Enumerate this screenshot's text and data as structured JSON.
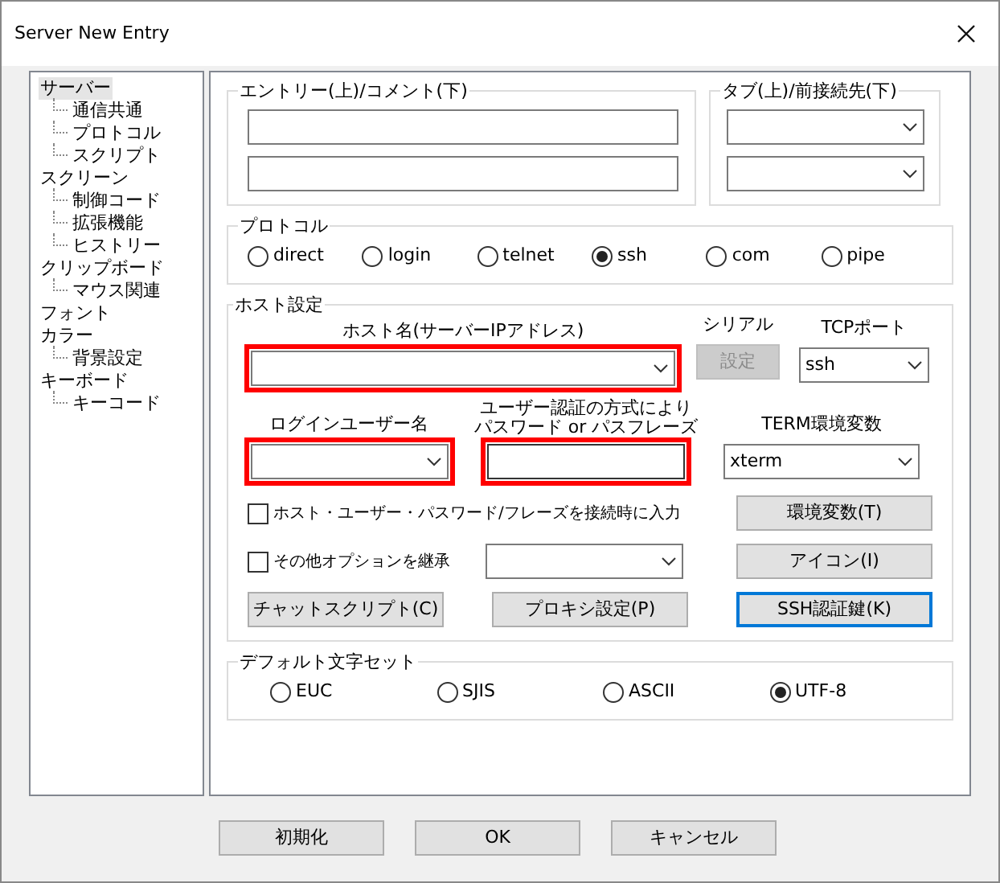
{
  "window": {
    "title": "Server New Entry"
  },
  "tree": [
    {
      "label": "サーバー",
      "selected": true,
      "children": [
        {
          "label": "通信共通",
          "selected": false
        },
        {
          "label": "プロトコル",
          "selected": false
        },
        {
          "label": "スクリプト",
          "selected": false
        }
      ]
    },
    {
      "label": "スクリーン",
      "selected": false,
      "children": [
        {
          "label": "制御コード",
          "selected": false
        },
        {
          "label": "拡張機能",
          "selected": false
        },
        {
          "label": "ヒストリー",
          "selected": false
        }
      ]
    },
    {
      "label": "クリップボード",
      "selected": false,
      "children": [
        {
          "label": "マウス関連",
          "selected": false
        }
      ]
    },
    {
      "label": "フォント",
      "selected": false
    },
    {
      "label": "カラー",
      "selected": false,
      "children": [
        {
          "label": "背景設定",
          "selected": false
        }
      ]
    },
    {
      "label": "キーボード",
      "selected": false,
      "children": [
        {
          "label": "キーコード",
          "selected": false
        }
      ]
    }
  ],
  "entry_group": {
    "title": "エントリー(上)/コメント(下)"
  },
  "tab_group": {
    "title": "タブ(上)/前接続先(下)"
  },
  "protocol": {
    "title": "プロトコル",
    "options": [
      {
        "label": "direct",
        "selected": false
      },
      {
        "label": "login",
        "selected": false
      },
      {
        "label": "telnet",
        "selected": false
      },
      {
        "label": "ssh",
        "selected": true
      },
      {
        "label": "com",
        "selected": false
      },
      {
        "label": "pipe",
        "selected": false
      }
    ]
  },
  "host": {
    "title": "ホスト設定",
    "host_label": "ホスト名(サーバーIPアドレス)",
    "host_highlighted": true,
    "serial_label": "シリアル",
    "serial_button": {
      "label": "設定",
      "disabled": true
    },
    "port_label": "TCPポート",
    "port_value": "ssh",
    "login_label": "ログインユーザー名",
    "login_highlighted": true,
    "password_label": [
      "ユーザー認証の方式により",
      "パスワード or パスフレーズ"
    ],
    "password_highlighted": true,
    "term_label": "TERM環境変数",
    "term_value": "xterm",
    "checkboxes": [
      {
        "label": "ホスト・ユーザー・パスワード/フレーズを接続時に入力",
        "checked": false
      },
      {
        "label": "その他オプションを継承",
        "checked": false
      }
    ],
    "side_buttons": [
      {
        "label": "環境変数(T)",
        "focused": false
      },
      {
        "label": "アイコン(I)",
        "focused": false
      }
    ],
    "bottom_buttons": [
      {
        "label": "チャットスクリプト(C)",
        "focused": false
      },
      {
        "label": "プロキシ設定(P)",
        "focused": false
      },
      {
        "label": "SSH認証鍵(K)",
        "focused": true
      }
    ]
  },
  "charset": {
    "title": "デフォルト文字セット",
    "options": [
      {
        "label": "EUC",
        "selected": false
      },
      {
        "label": "SJIS",
        "selected": false
      },
      {
        "label": "ASCII",
        "selected": false
      },
      {
        "label": "UTF-8",
        "selected": true
      }
    ]
  },
  "footer_buttons": [
    "初期化",
    "OK",
    "キャンセル"
  ]
}
